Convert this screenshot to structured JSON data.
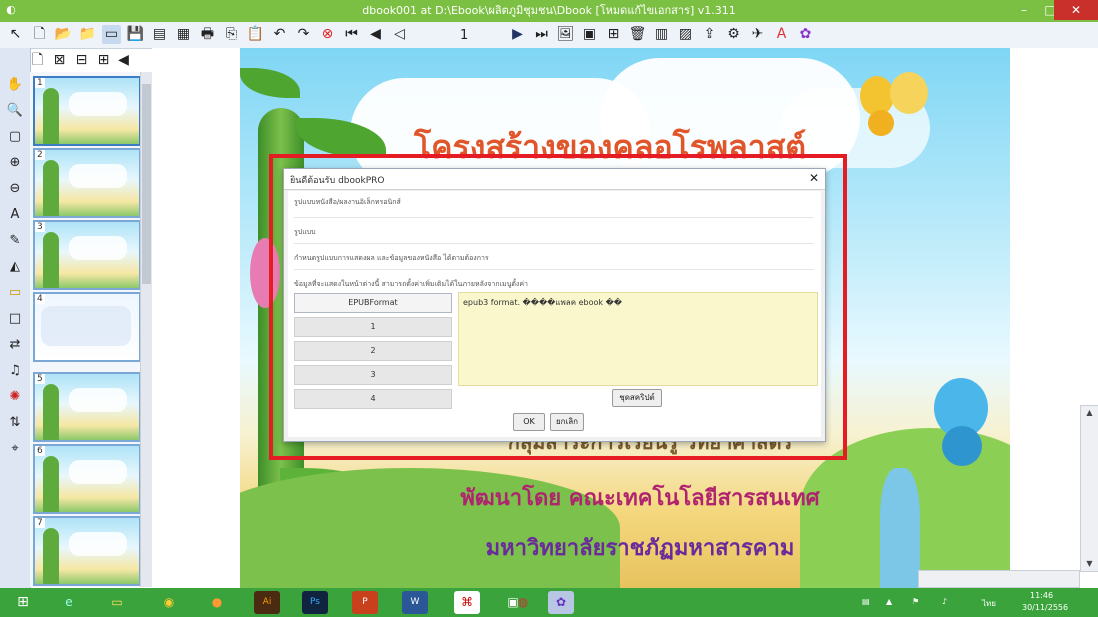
{
  "window": {
    "title": "dbook001 at D:\\Ebook\\ผลิตภูมิชุมชน\\Dbook [โหมดแก้ไขเอกสาร] v1.311",
    "app_icon": "app-icon",
    "min_label": "–",
    "max_label": "□",
    "close_label": "✕"
  },
  "toolbar": {
    "page_number": "1",
    "icons": [
      "pointer-icon",
      "new-page-icon",
      "open-icon",
      "open-folder-icon",
      "book-icon",
      "save-icon",
      "save-as-icon",
      "print-preview-icon",
      "print-icon",
      "copy-icon",
      "paste-icon",
      "undo-icon",
      "redo-icon",
      "link-icon",
      "first-page-icon",
      "prev-page-icon",
      "next-page-icon",
      "last-page-icon",
      "image-icon",
      "video-icon",
      "puzzle-icon",
      "trash-icon",
      "table-icon",
      "chart-icon",
      "export-icon",
      "settings-icon",
      "publish-icon",
      "text-icon",
      "plugin-icon"
    ]
  },
  "tools": {
    "icons": [
      "eraser-icon",
      "new-icon",
      "close-doc-icon",
      "grid-icon",
      "group-icon",
      "hand-icon",
      "zoom-icon",
      "frame-icon",
      "zoom-in-icon",
      "zoom-out-icon",
      "text-tool-icon",
      "paint-icon",
      "fill-icon",
      "note-icon",
      "rect-icon",
      "connector-icon",
      "audio-icon",
      "shape-icon",
      "flip-icon",
      "camera-icon"
    ]
  },
  "thumbnails": [
    {
      "number": "1"
    },
    {
      "number": "2"
    },
    {
      "number": "3"
    },
    {
      "number": "4"
    },
    {
      "number": "5"
    },
    {
      "number": "6"
    },
    {
      "number": "7"
    }
  ],
  "slide": {
    "title": "โครงสร้างของคลอโรพลาสต์",
    "subtitle": "กลุ่มสาระการเรียนรู้ วิทยาศาสตร์",
    "developer": "พัฒนาโดย คณะเทคโนโลยีสารสนเทศ",
    "university": "มหาวิทยาลัยราชภัฏมหาสารคาม"
  },
  "dialog": {
    "title": "ยินดีต้อนรับ dbookPRO",
    "close_label": "✕",
    "lines": [
      "รูปแบบหนังสือ/ผลงานอิเล็กทรอนิกส์",
      "รูปแบบ",
      "กำหนดรูปแบบการแสดงผล และข้อมูลของหนังสือ ได้ตามต้องการ",
      "ข้อมูลที่จะแสดงในหน้าต่างนี้ สามารถตั้งค่าเพิ่มเติมได้ในภายหลังจากเมนูตั้งค่า"
    ],
    "format_buttons": [
      "EPUBFormat",
      "1",
      "2",
      "3",
      "4"
    ],
    "text_content": "epub3 format. ����แพลค ebook ��",
    "browse_label": "ชุดสคริปต์",
    "ok_label": "OK",
    "cancel_label": "ยกเลิก"
  },
  "taskbar": {
    "apps": [
      "windows-start-icon",
      "ie-icon",
      "file-explorer-icon",
      "chrome-icon",
      "firefox-icon",
      "illustrator-icon",
      "photoshop-icon",
      "powerpoint-icon",
      "word-icon",
      "acrobat-icon",
      "picture-icon",
      "media-icon",
      "dbook-icon"
    ],
    "tray_lang": "ไทย",
    "time": "11:46",
    "date": "30/11/2556"
  },
  "colors": {
    "titlebar": "#7bc043",
    "taskbar": "#3aa33b",
    "highlight": "#e51c23",
    "text_panel": "#fbf7cc",
    "slide_title": "#e0562a"
  }
}
